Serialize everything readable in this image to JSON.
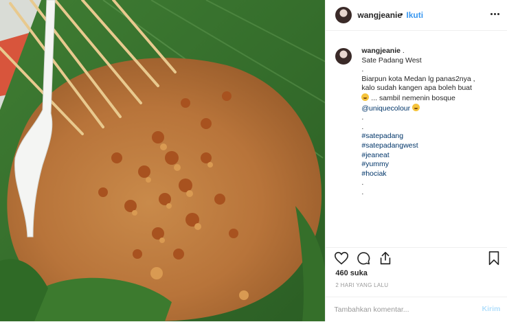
{
  "post": {
    "username": "wangjeanie",
    "separator": "•",
    "follow_label": "Ikuti",
    "more_icon": "more-options-icon"
  },
  "caption": {
    "username": "wangjeanie",
    "lines": [
      ".",
      "Sate Padang West",
      ".",
      "Biarpun kota Medan lg panas2nya ,",
      "kalo sudah kangen apa boleh buat",
      "... sambil nemenin bosque",
      "@uniquecolour",
      ".",
      ".",
      "#satepadang",
      "#satepadangwest",
      "#jeaneat",
      "#yummy",
      "#hociak",
      ".",
      "."
    ]
  },
  "actions": {
    "like_icon": "heart-icon",
    "comment_icon": "comment-icon",
    "share_icon": "share-icon",
    "save_icon": "bookmark-icon"
  },
  "likes_text": "460 suka",
  "timestamp": "2 HARI YANG LALU",
  "comment_box": {
    "placeholder": "Tambahkan komentar...",
    "send_label": "Kirim"
  },
  "colors": {
    "link_blue": "#3897f0",
    "hashtag": "#003569",
    "send_disabled": "#b2dffc"
  }
}
